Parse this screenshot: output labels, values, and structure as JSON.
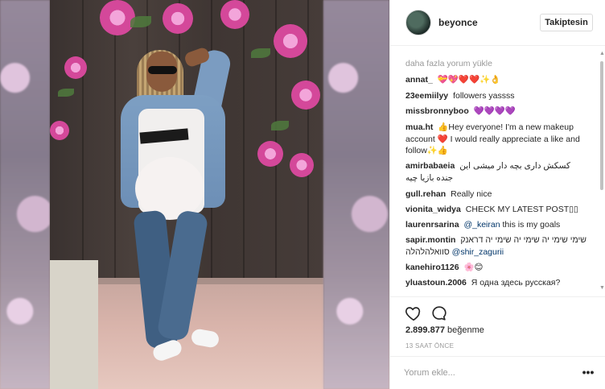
{
  "post": {
    "username": "beyonce",
    "follow_label": "Takiptesin",
    "load_more_label": "daha fazla yorum yükle",
    "comments": [
      {
        "user": "annat_",
        "text": "💝💖❤️❤️✨👌"
      },
      {
        "user": "23eemiilyy",
        "text": "followers yassss"
      },
      {
        "user": "missbronnyboo",
        "text": "💜💜💜💜"
      },
      {
        "user": "mua.ht",
        "text": "👍Hey everyone! I'm a new makeup account ❤️ I would really appreciate a like and follow✨👍"
      },
      {
        "user": "amirbabaeia",
        "text": "کسکش داری بچه دار میشی این جنده بازیا چیه"
      },
      {
        "user": "gull.rehan",
        "text": "Really nice"
      },
      {
        "user": "vionita_widya",
        "text": "CHECK MY LATEST POST▯▯"
      },
      {
        "user": "laurenrsarina",
        "mention": "@_keiran",
        "text": "this is my goals"
      },
      {
        "user": "sapir.montin",
        "text": "שימי שימי יה שימי יה שימי יה דראנק סוואלהלהלה",
        "mention": "@shir_zagurii"
      },
      {
        "user": "kanehiro1126",
        "text": "🌸😊"
      },
      {
        "user": "yluastoun.2006",
        "text": "Я одна здесь русская?"
      }
    ],
    "likes_count": "2.899.877",
    "likes_label": "beğenme",
    "time_ago": "13 SAAT ÖNCE",
    "comment_placeholder": "Yorum ekle...",
    "more_label": "•••"
  },
  "icons": {
    "like": "heart-icon",
    "comment": "speech-bubble-icon",
    "more": "more-options-icon",
    "scroll_up": "scroll-up-arrow-icon",
    "scroll_down": "scroll-down-arrow-icon"
  },
  "colors": {
    "text": "#262626",
    "muted": "#999999",
    "link": "#003569",
    "border": "#efefef"
  }
}
